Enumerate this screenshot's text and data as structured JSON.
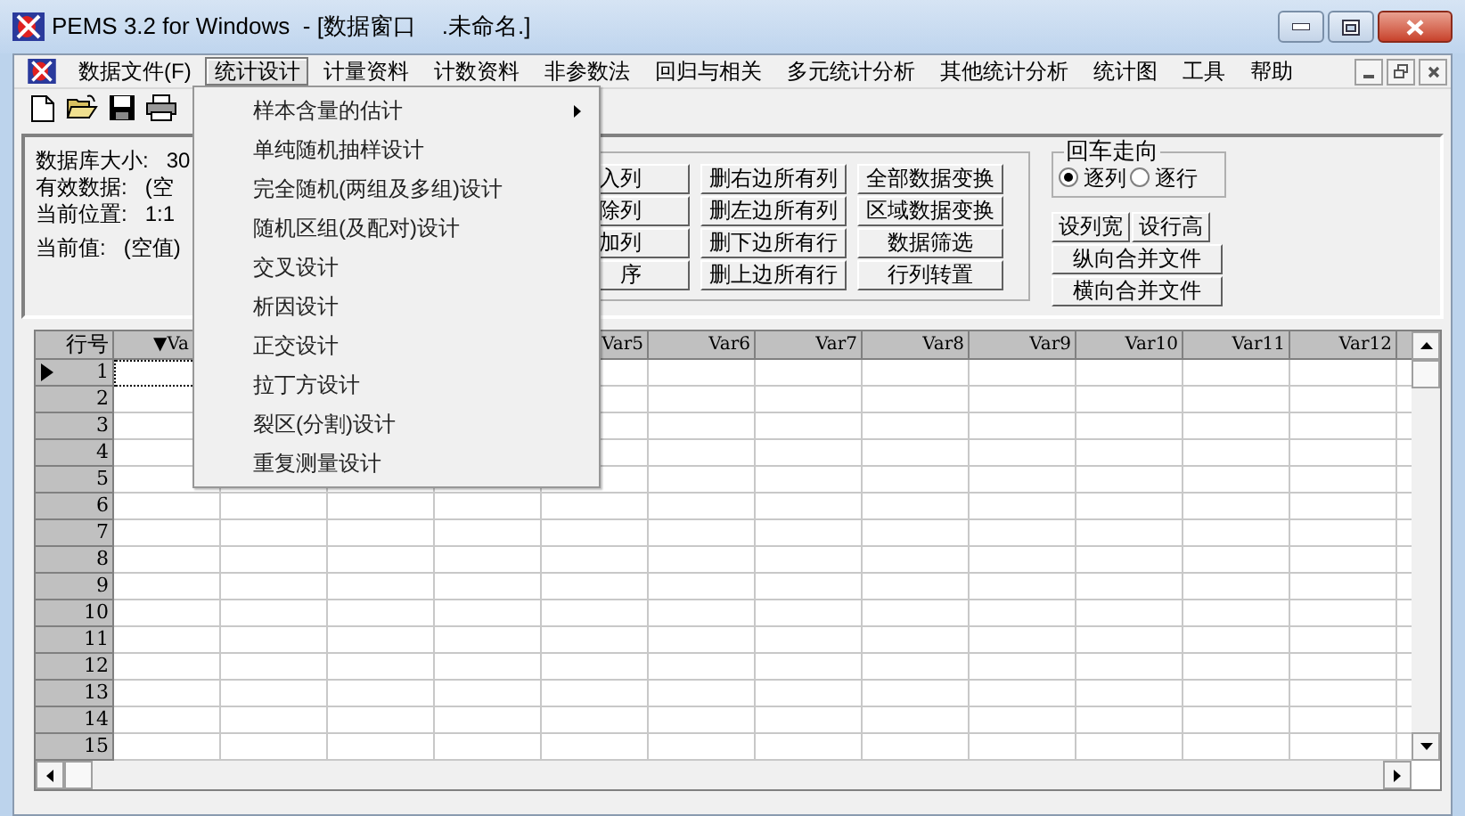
{
  "window": {
    "title": "PEMS 3.2 for Windows  - [数据窗口    .未命名.]"
  },
  "menu_bar": {
    "items": [
      {
        "label": "数据文件(F)",
        "selected": false
      },
      {
        "label": "统计设计",
        "selected": true
      },
      {
        "label": "计量资料",
        "selected": false
      },
      {
        "label": "计数资料",
        "selected": false
      },
      {
        "label": "非参数法",
        "selected": false
      },
      {
        "label": "回归与相关",
        "selected": false
      },
      {
        "label": "多元统计分析",
        "selected": false
      },
      {
        "label": "其他统计分析",
        "selected": false
      },
      {
        "label": "统计图",
        "selected": false
      },
      {
        "label": "工具",
        "selected": false
      },
      {
        "label": "帮助",
        "selected": false
      }
    ]
  },
  "dropdown": {
    "items": [
      {
        "label": "样本含量的估计",
        "submenu": true
      },
      {
        "label": "单纯随机抽样设计",
        "submenu": false
      },
      {
        "label": "完全随机(两组及多组)设计",
        "submenu": false
      },
      {
        "label": "随机区组(及配对)设计",
        "submenu": false
      },
      {
        "label": "交叉设计",
        "submenu": false
      },
      {
        "label": "析因设计",
        "submenu": false
      },
      {
        "label": "正交设计",
        "submenu": false
      },
      {
        "label": "拉丁方设计",
        "submenu": false
      },
      {
        "label": "裂区(分割)设计",
        "submenu": false
      },
      {
        "label": "重复测量设计",
        "submenu": false
      }
    ]
  },
  "info_panel": {
    "rows": [
      {
        "label": "数据库大小:",
        "value": "30"
      },
      {
        "label": "有效数据:",
        "value": "(空"
      },
      {
        "label": "当前位置:",
        "value": "1:1"
      },
      {
        "label": "当前值:",
        "value": "(空值)"
      }
    ]
  },
  "edit_buttons": [
    [
      "入列",
      "删右边所有列",
      "全部数据变换"
    ],
    [
      "除列",
      "删左边所有列",
      "区域数据变换"
    ],
    [
      "加列",
      "删下边所有行",
      "数据筛选"
    ],
    [
      "序",
      "删上边所有行",
      "行列转置"
    ]
  ],
  "enter_direction": {
    "title": "回车走向",
    "options": [
      {
        "label": "逐列",
        "selected": true
      },
      {
        "label": "逐行",
        "selected": false
      }
    ]
  },
  "size_buttons": [
    "设列宽",
    "设行高"
  ],
  "merge_buttons": [
    "纵向合并文件",
    "横向合并文件"
  ],
  "grid": {
    "row_header": "行号",
    "columns": [
      "▼Va",
      "Var5",
      "Var6",
      "Var7",
      "Var8",
      "Var9",
      "Var10",
      "Var11",
      "Var12"
    ],
    "rows": [
      {
        "label": "1",
        "current": true
      },
      {
        "label": "2",
        "current": false
      },
      {
        "label": "3",
        "current": false
      },
      {
        "label": "4",
        "current": false
      },
      {
        "label": "5",
        "current": false
      },
      {
        "label": "6",
        "current": false
      },
      {
        "label": "7",
        "current": false
      },
      {
        "label": "8",
        "current": false
      },
      {
        "label": "9",
        "current": false
      },
      {
        "label": "10",
        "current": false
      },
      {
        "label": "11",
        "current": false
      },
      {
        "label": "12",
        "current": false
      },
      {
        "label": "13",
        "current": false
      },
      {
        "label": "14",
        "current": false
      },
      {
        "label": "15",
        "current": false
      }
    ]
  }
}
